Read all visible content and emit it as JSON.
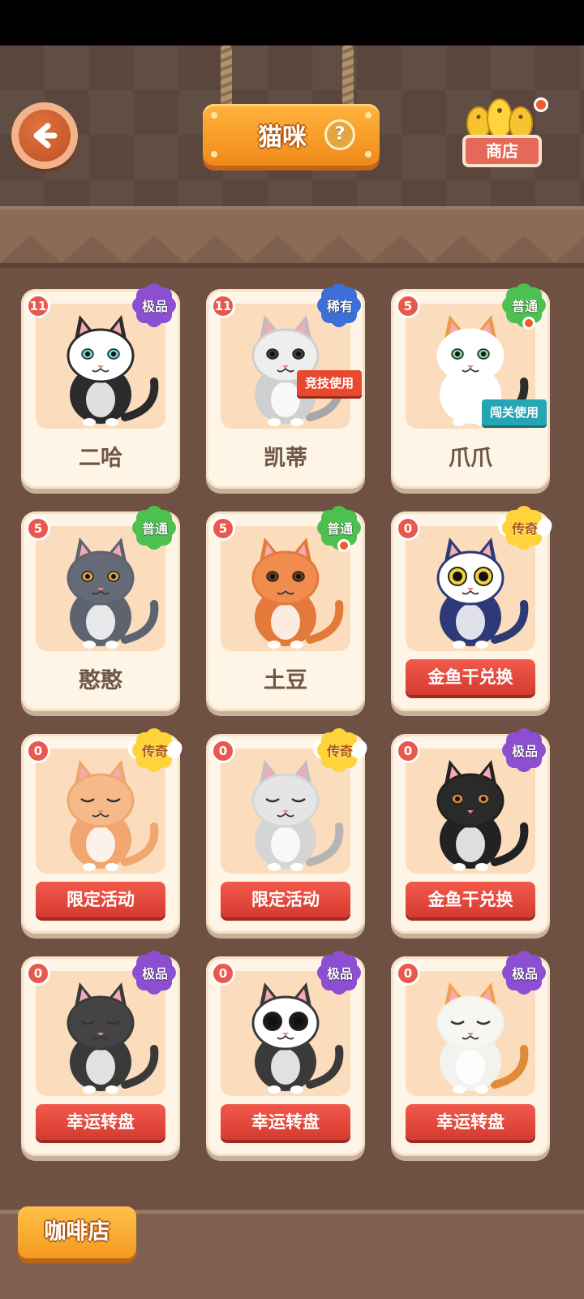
{
  "header": {
    "title": "猫咪",
    "help_label": "?",
    "shop_label": "商店"
  },
  "colors": {
    "accent_orange": "#f39a1d",
    "action_red": "#e0463b",
    "background_brown": "#6e5143",
    "card_bg": "#fff5e6"
  },
  "cats": [
    {
      "level": "11",
      "rarity": "极品",
      "rarity_color": "purple",
      "name": "二哈",
      "tag": "",
      "action": ""
    },
    {
      "level": "11",
      "rarity": "稀有",
      "rarity_color": "blue",
      "name": "凯蒂",
      "tag": "竞技使用",
      "action": ""
    },
    {
      "level": "5",
      "rarity": "普通",
      "rarity_color": "green",
      "name": "爪爪",
      "tag": "闯关使用",
      "action": ""
    },
    {
      "level": "5",
      "rarity": "普通",
      "rarity_color": "green",
      "name": "憨憨",
      "tag": "",
      "action": ""
    },
    {
      "level": "5",
      "rarity": "普通",
      "rarity_color": "green",
      "name": "土豆",
      "tag": "",
      "action": ""
    },
    {
      "level": "0",
      "rarity": "传奇",
      "rarity_color": "gold",
      "name": "",
      "tag": "",
      "action": "金鱼干兑换"
    },
    {
      "level": "0",
      "rarity": "传奇",
      "rarity_color": "gold",
      "name": "",
      "tag": "",
      "action": "限定活动"
    },
    {
      "level": "0",
      "rarity": "传奇",
      "rarity_color": "gold",
      "name": "",
      "tag": "",
      "action": "限定活动"
    },
    {
      "level": "0",
      "rarity": "极品",
      "rarity_color": "purple",
      "name": "",
      "tag": "",
      "action": "金鱼干兑换"
    },
    {
      "level": "0",
      "rarity": "极品",
      "rarity_color": "purple",
      "name": "",
      "tag": "",
      "action": "幸运转盘"
    },
    {
      "level": "0",
      "rarity": "极品",
      "rarity_color": "purple",
      "name": "",
      "tag": "",
      "action": "幸运转盘"
    },
    {
      "level": "0",
      "rarity": "极品",
      "rarity_color": "purple",
      "name": "",
      "tag": "",
      "action": "幸运转盘"
    }
  ],
  "footer": {
    "cafe_label": "咖啡店"
  }
}
